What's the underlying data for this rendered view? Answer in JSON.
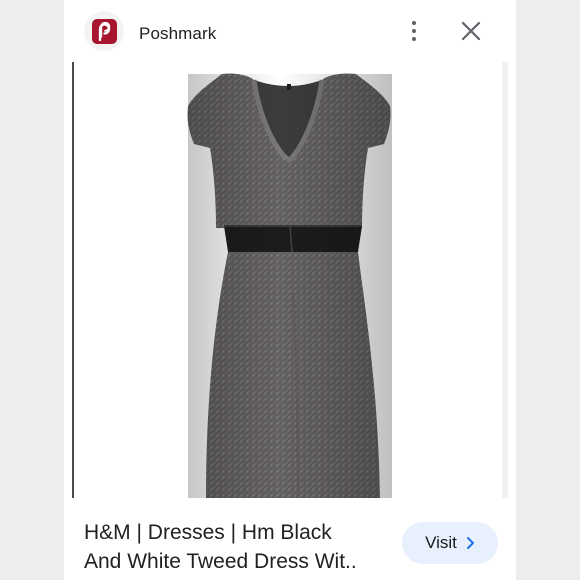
{
  "header": {
    "source_name": "Poshmark",
    "logo_icon": "poshmark-logo-icon",
    "more_icon": "more-vert-icon",
    "close_icon": "close-icon",
    "brand_color": "#a7152f"
  },
  "image": {
    "subject_icon": "dress-photo"
  },
  "result": {
    "title_line1": "H&M | Dresses | Hm Black",
    "title_line2": "And White Tweed Dress Wit..",
    "visit_label": "Visit",
    "visit_icon": "chevron-right-icon",
    "visit_bg": "#e8f0fe"
  }
}
